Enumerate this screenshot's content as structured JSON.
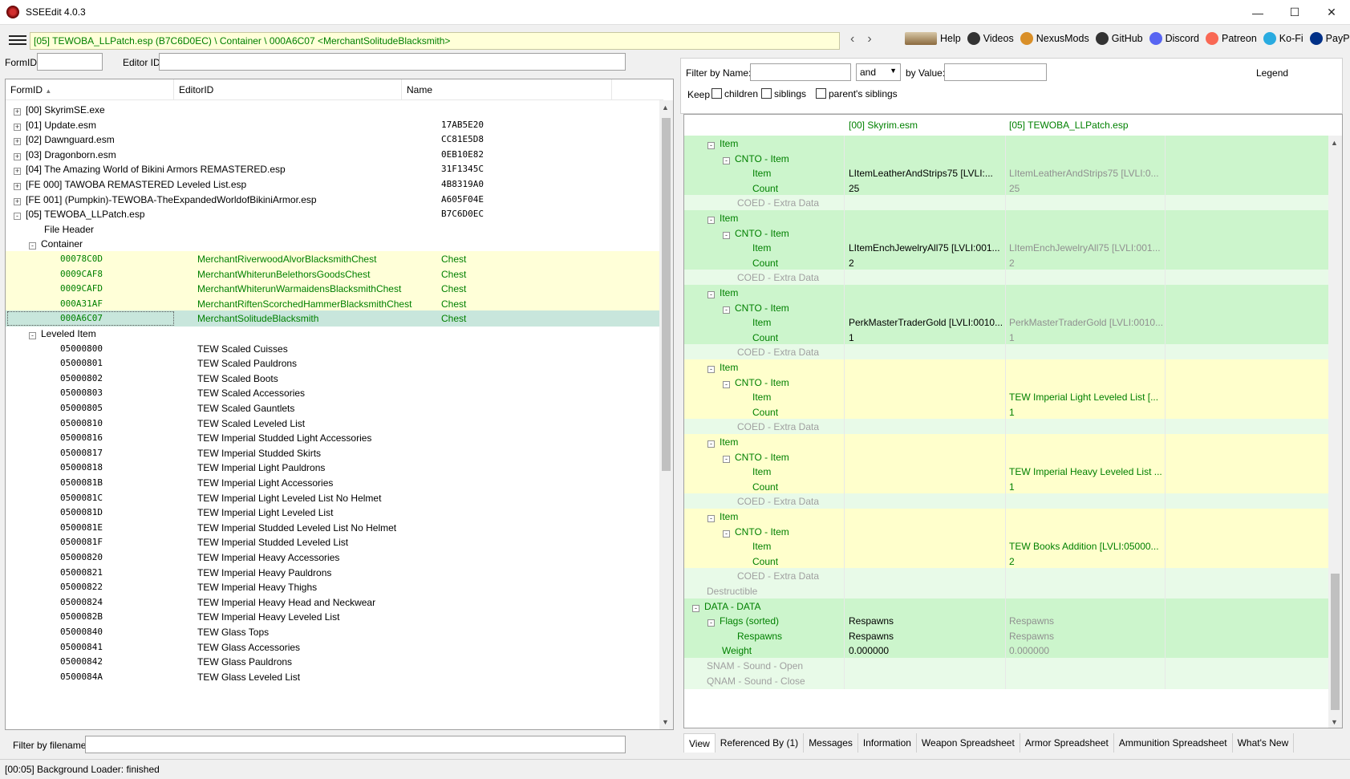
{
  "window": {
    "title": "SSEEdit 4.0.3",
    "minimize": "—",
    "maximize": "☐",
    "close": "✕"
  },
  "toolbar": {
    "path": "[05] TEWOBA_LLPatch.esp (B7C6D0EC) \\ Container \\ 000A6C07 <MerchantSolitudeBlacksmith>",
    "back": "‹",
    "forward": "›",
    "links": [
      {
        "label": "Help",
        "icon": "book-icon",
        "color": "#6b4a2a"
      },
      {
        "label": "Videos",
        "icon": "film-icon",
        "color": "#333333"
      },
      {
        "label": "NexusMods",
        "icon": "nexus-icon",
        "color": "#d98f28"
      },
      {
        "label": "GitHub",
        "icon": "github-icon",
        "color": "#333333"
      },
      {
        "label": "Discord",
        "icon": "discord-icon",
        "color": "#5865f2"
      },
      {
        "label": "Patreon",
        "icon": "patreon-icon",
        "color": "#f96854"
      },
      {
        "label": "Ko-Fi",
        "icon": "kofi-icon",
        "color": "#29abe0"
      },
      {
        "label": "PayPal",
        "icon": "paypal-icon",
        "color": "#003087"
      }
    ]
  },
  "left": {
    "formid_label": "FormID",
    "editorid_label": "Editor ID",
    "columns": [
      "FormID",
      "EditorID",
      "Name"
    ],
    "filter_label": "Filter by filename:",
    "rows": [
      {
        "indent": 0,
        "exp": "+",
        "c1": "[00] SkyrimSE.exe",
        "c2": "",
        "c3": "",
        "style": ""
      },
      {
        "indent": 0,
        "exp": "+",
        "c1": "[01] Update.esm",
        "c2": "",
        "c3": "17AB5E20",
        "style": ""
      },
      {
        "indent": 0,
        "exp": "+",
        "c1": "[02] Dawnguard.esm",
        "c2": "",
        "c3": "CC81E5D8",
        "style": ""
      },
      {
        "indent": 0,
        "exp": "+",
        "c1": "[03] Dragonborn.esm",
        "c2": "",
        "c3": "0EB10E82",
        "style": ""
      },
      {
        "indent": 0,
        "exp": "+",
        "c1": "[04] The Amazing World of Bikini Armors REMASTERED.esp",
        "c2": "",
        "c3": "31F1345C",
        "style": ""
      },
      {
        "indent": 0,
        "exp": "+",
        "c1": "[FE 000] TAWOBA REMASTERED Leveled List.esp",
        "c2": "",
        "c3": "4B8319A0",
        "style": ""
      },
      {
        "indent": 0,
        "exp": "+",
        "c1": "[FE 001] (Pumpkin)-TEWOBA-TheExpandedWorldofBikiniArmor.esp",
        "c2": "",
        "c3": "A605F04E",
        "style": ""
      },
      {
        "indent": 0,
        "exp": "-",
        "c1": "[05] TEWOBA_LLPatch.esp",
        "c2": "",
        "c3": "B7C6D0EC",
        "style": ""
      },
      {
        "indent": 1,
        "exp": "",
        "c1": "File Header",
        "c2": "",
        "c3": "",
        "style": ""
      },
      {
        "indent": 1,
        "exp": "-",
        "c1": "Container",
        "c2": "",
        "c3": "",
        "style": ""
      },
      {
        "indent": 2,
        "exp": "",
        "c1": "00078C0D",
        "c2": "MerchantRiverwoodAlvorBlacksmithChest",
        "c3": "Chest",
        "style": "y"
      },
      {
        "indent": 2,
        "exp": "",
        "c1": "0009CAF8",
        "c2": "MerchantWhiterunBelethorsGoodsChest",
        "c3": "Chest",
        "style": "y"
      },
      {
        "indent": 2,
        "exp": "",
        "c1": "0009CAFD",
        "c2": "MerchantWhiterunWarmaidensBlacksmithChest",
        "c3": "Chest",
        "style": "y"
      },
      {
        "indent": 2,
        "exp": "",
        "c1": "000A31AF",
        "c2": "MerchantRiftenScorchedHammerBlacksmithChest",
        "c3": "Chest",
        "style": "y"
      },
      {
        "indent": 2,
        "exp": "",
        "c1": "000A6C07",
        "c2": "MerchantSolitudeBlacksmith",
        "c3": "Chest",
        "style": "sel"
      },
      {
        "indent": 1,
        "exp": "-",
        "c1": "Leveled Item",
        "c2": "",
        "c3": "",
        "style": ""
      },
      {
        "indent": 2,
        "exp": "",
        "c1": "05000800",
        "c2": "TEW Scaled Cuisses",
        "c3": "",
        "style": ""
      },
      {
        "indent": 2,
        "exp": "",
        "c1": "05000801",
        "c2": "TEW Scaled Pauldrons",
        "c3": "",
        "style": ""
      },
      {
        "indent": 2,
        "exp": "",
        "c1": "05000802",
        "c2": "TEW Scaled Boots",
        "c3": "",
        "style": ""
      },
      {
        "indent": 2,
        "exp": "",
        "c1": "05000803",
        "c2": "TEW Scaled Accessories",
        "c3": "",
        "style": ""
      },
      {
        "indent": 2,
        "exp": "",
        "c1": "05000805",
        "c2": "TEW Scaled Gauntlets",
        "c3": "",
        "style": ""
      },
      {
        "indent": 2,
        "exp": "",
        "c1": "05000810",
        "c2": "TEW Scaled Leveled List",
        "c3": "",
        "style": ""
      },
      {
        "indent": 2,
        "exp": "",
        "c1": "05000816",
        "c2": "TEW Imperial Studded Light Accessories",
        "c3": "",
        "style": ""
      },
      {
        "indent": 2,
        "exp": "",
        "c1": "05000817",
        "c2": "TEW Imperial Studded Skirts",
        "c3": "",
        "style": ""
      },
      {
        "indent": 2,
        "exp": "",
        "c1": "05000818",
        "c2": "TEW Imperial Light Pauldrons",
        "c3": "",
        "style": ""
      },
      {
        "indent": 2,
        "exp": "",
        "c1": "0500081B",
        "c2": "TEW Imperial Light Accessories",
        "c3": "",
        "style": ""
      },
      {
        "indent": 2,
        "exp": "",
        "c1": "0500081C",
        "c2": "TEW Imperial Light Leveled List No Helmet",
        "c3": "",
        "style": ""
      },
      {
        "indent": 2,
        "exp": "",
        "c1": "0500081D",
        "c2": "TEW Imperial Light Leveled List",
        "c3": "",
        "style": ""
      },
      {
        "indent": 2,
        "exp": "",
        "c1": "0500081E",
        "c2": "TEW Imperial Studded Leveled List No Helmet",
        "c3": "",
        "style": ""
      },
      {
        "indent": 2,
        "exp": "",
        "c1": "0500081F",
        "c2": "TEW Imperial Studded Leveled List",
        "c3": "",
        "style": ""
      },
      {
        "indent": 2,
        "exp": "",
        "c1": "05000820",
        "c2": "TEW Imperial Heavy Accessories",
        "c3": "",
        "style": ""
      },
      {
        "indent": 2,
        "exp": "",
        "c1": "05000821",
        "c2": "TEW Imperial Heavy Pauldrons",
        "c3": "",
        "style": ""
      },
      {
        "indent": 2,
        "exp": "",
        "c1": "05000822",
        "c2": "TEW Imperial Heavy Thighs",
        "c3": "",
        "style": ""
      },
      {
        "indent": 2,
        "exp": "",
        "c1": "05000824",
        "c2": "TEW Imperial Heavy Head and Neckwear",
        "c3": "",
        "style": ""
      },
      {
        "indent": 2,
        "exp": "",
        "c1": "0500082B",
        "c2": "TEW Imperial Heavy Leveled List",
        "c3": "",
        "style": ""
      },
      {
        "indent": 2,
        "exp": "",
        "c1": "05000840",
        "c2": "TEW Glass Tops",
        "c3": "",
        "style": ""
      },
      {
        "indent": 2,
        "exp": "",
        "c1": "05000841",
        "c2": "TEW Glass Accessories",
        "c3": "",
        "style": ""
      },
      {
        "indent": 2,
        "exp": "",
        "c1": "05000842",
        "c2": "TEW Glass Pauldrons",
        "c3": "",
        "style": ""
      },
      {
        "indent": 2,
        "exp": "",
        "c1": "0500084A",
        "c2": "TEW Glass Leveled List",
        "c3": "",
        "style": ""
      }
    ]
  },
  "right": {
    "filter_name_label": "Filter by Name:",
    "and_value": "and",
    "by_value_label": "by Value:",
    "legend": "Legend",
    "keep_label": "Keep",
    "chk_children": "children",
    "chk_siblings": "siblings",
    "chk_parents": "parent's siblings",
    "col1": "[00] Skyrim.esm",
    "col2": "[05] TEWOBA_LLPatch.esp",
    "rows": [
      {
        "d": 1,
        "exp": "-",
        "lab": "Item",
        "v1": "",
        "v2": "",
        "bg": "g",
        "labc": "g",
        "v2c": ""
      },
      {
        "d": 2,
        "exp": "-",
        "lab": "CNTO - Item",
        "v1": "",
        "v2": "",
        "bg": "g",
        "labc": "g",
        "v2c": ""
      },
      {
        "d": 3,
        "exp": "",
        "lab": "Item",
        "v1": "LItemLeatherAndStrips75 [LVLI:...",
        "v2": "LItemLeatherAndStrips75 [LVLI:0...",
        "bg": "g",
        "labc": "g",
        "v2c": ""
      },
      {
        "d": 3,
        "exp": "",
        "lab": "Count",
        "v1": "25",
        "v2": "25",
        "bg": "g",
        "labc": "g",
        "v2c": ""
      },
      {
        "d": 2,
        "exp": "",
        "lab": "COED - Extra Data",
        "v1": "",
        "v2": "",
        "bg": "lg",
        "labc": "gray",
        "v2c": ""
      },
      {
        "d": 1,
        "exp": "-",
        "lab": "Item",
        "v1": "",
        "v2": "",
        "bg": "g",
        "labc": "g",
        "v2c": ""
      },
      {
        "d": 2,
        "exp": "-",
        "lab": "CNTO - Item",
        "v1": "",
        "v2": "",
        "bg": "g",
        "labc": "g",
        "v2c": ""
      },
      {
        "d": 3,
        "exp": "",
        "lab": "Item",
        "v1": "LItemEnchJewelryAll75 [LVLI:001...",
        "v2": "LItemEnchJewelryAll75 [LVLI:001...",
        "bg": "g",
        "labc": "g",
        "v2c": ""
      },
      {
        "d": 3,
        "exp": "",
        "lab": "Count",
        "v1": "2",
        "v2": "2",
        "bg": "g",
        "labc": "g",
        "v2c": ""
      },
      {
        "d": 2,
        "exp": "",
        "lab": "COED - Extra Data",
        "v1": "",
        "v2": "",
        "bg": "lg",
        "labc": "gray",
        "v2c": ""
      },
      {
        "d": 1,
        "exp": "-",
        "lab": "Item",
        "v1": "",
        "v2": "",
        "bg": "g",
        "labc": "g",
        "v2c": ""
      },
      {
        "d": 2,
        "exp": "-",
        "lab": "CNTO - Item",
        "v1": "",
        "v2": "",
        "bg": "g",
        "labc": "g",
        "v2c": ""
      },
      {
        "d": 3,
        "exp": "",
        "lab": "Item",
        "v1": "PerkMasterTraderGold [LVLI:0010...",
        "v2": "PerkMasterTraderGold [LVLI:0010...",
        "bg": "g",
        "labc": "g",
        "v2c": ""
      },
      {
        "d": 3,
        "exp": "",
        "lab": "Count",
        "v1": "1",
        "v2": "1",
        "bg": "g",
        "labc": "g",
        "v2c": ""
      },
      {
        "d": 2,
        "exp": "",
        "lab": "COED - Extra Data",
        "v1": "",
        "v2": "",
        "bg": "lg",
        "labc": "gray",
        "v2c": ""
      },
      {
        "d": 1,
        "exp": "-",
        "lab": "Item",
        "v1": "",
        "v2": "",
        "bg": "y",
        "labc": "g",
        "v2c": ""
      },
      {
        "d": 2,
        "exp": "-",
        "lab": "CNTO - Item",
        "v1": "",
        "v2": "",
        "bg": "y",
        "labc": "g",
        "v2c": ""
      },
      {
        "d": 3,
        "exp": "",
        "lab": "Item",
        "v1": "",
        "v2": "TEW Imperial Light Leveled List [...",
        "bg": "y",
        "labc": "g",
        "v2c": "g"
      },
      {
        "d": 3,
        "exp": "",
        "lab": "Count",
        "v1": "",
        "v2": "1",
        "bg": "y",
        "labc": "g",
        "v2c": "g"
      },
      {
        "d": 2,
        "exp": "",
        "lab": "COED - Extra Data",
        "v1": "",
        "v2": "",
        "bg": "lg",
        "labc": "gray",
        "v2c": ""
      },
      {
        "d": 1,
        "exp": "-",
        "lab": "Item",
        "v1": "",
        "v2": "",
        "bg": "y",
        "labc": "g",
        "v2c": ""
      },
      {
        "d": 2,
        "exp": "-",
        "lab": "CNTO - Item",
        "v1": "",
        "v2": "",
        "bg": "y",
        "labc": "g",
        "v2c": ""
      },
      {
        "d": 3,
        "exp": "",
        "lab": "Item",
        "v1": "",
        "v2": "TEW Imperial Heavy Leveled List ...",
        "bg": "y",
        "labc": "g",
        "v2c": "g"
      },
      {
        "d": 3,
        "exp": "",
        "lab": "Count",
        "v1": "",
        "v2": "1",
        "bg": "y",
        "labc": "g",
        "v2c": "g"
      },
      {
        "d": 2,
        "exp": "",
        "lab": "COED - Extra Data",
        "v1": "",
        "v2": "",
        "bg": "lg",
        "labc": "gray",
        "v2c": ""
      },
      {
        "d": 1,
        "exp": "-",
        "lab": "Item",
        "v1": "",
        "v2": "",
        "bg": "y",
        "labc": "g",
        "v2c": ""
      },
      {
        "d": 2,
        "exp": "-",
        "lab": "CNTO - Item",
        "v1": "",
        "v2": "",
        "bg": "y",
        "labc": "g",
        "v2c": ""
      },
      {
        "d": 3,
        "exp": "",
        "lab": "Item",
        "v1": "",
        "v2": "TEW Books Addition [LVLI:05000...",
        "bg": "y",
        "labc": "g",
        "v2c": "g"
      },
      {
        "d": 3,
        "exp": "",
        "lab": "Count",
        "v1": "",
        "v2": "2",
        "bg": "y",
        "labc": "g",
        "v2c": "g"
      },
      {
        "d": 2,
        "exp": "",
        "lab": "COED - Extra Data",
        "v1": "",
        "v2": "",
        "bg": "lg",
        "labc": "gray",
        "v2c": ""
      },
      {
        "d": 0,
        "exp": "",
        "lab": "Destructible",
        "v1": "",
        "v2": "",
        "bg": "lg",
        "labc": "gray",
        "v2c": ""
      },
      {
        "d": 0,
        "exp": "-",
        "lab": "DATA - DATA",
        "v1": "",
        "v2": "",
        "bg": "g",
        "labc": "g",
        "v2c": ""
      },
      {
        "d": 1,
        "exp": "-",
        "lab": "Flags (sorted)",
        "v1": "Respawns",
        "v2": "Respawns",
        "bg": "g",
        "labc": "g",
        "v2c": ""
      },
      {
        "d": 2,
        "exp": "",
        "lab": "Respawns",
        "v1": "Respawns",
        "v2": "Respawns",
        "bg": "g",
        "labc": "g",
        "v2c": ""
      },
      {
        "d": 1,
        "exp": "",
        "lab": "Weight",
        "v1": "0.000000",
        "v2": "0.000000",
        "bg": "g",
        "labc": "g",
        "v2c": ""
      },
      {
        "d": 0,
        "exp": "",
        "lab": "SNAM - Sound - Open",
        "v1": "",
        "v2": "",
        "bg": "lg",
        "labc": "gray",
        "v2c": ""
      },
      {
        "d": 0,
        "exp": "",
        "lab": "QNAM - Sound - Close",
        "v1": "",
        "v2": "",
        "bg": "lg",
        "labc": "gray",
        "v2c": ""
      }
    ],
    "tabs": [
      "View",
      "Referenced By (1)",
      "Messages",
      "Information",
      "Weapon Spreadsheet",
      "Armor Spreadsheet",
      "Ammunition Spreadsheet",
      "What's New"
    ]
  },
  "status": {
    "text": "[00:05] Background Loader: finished"
  }
}
